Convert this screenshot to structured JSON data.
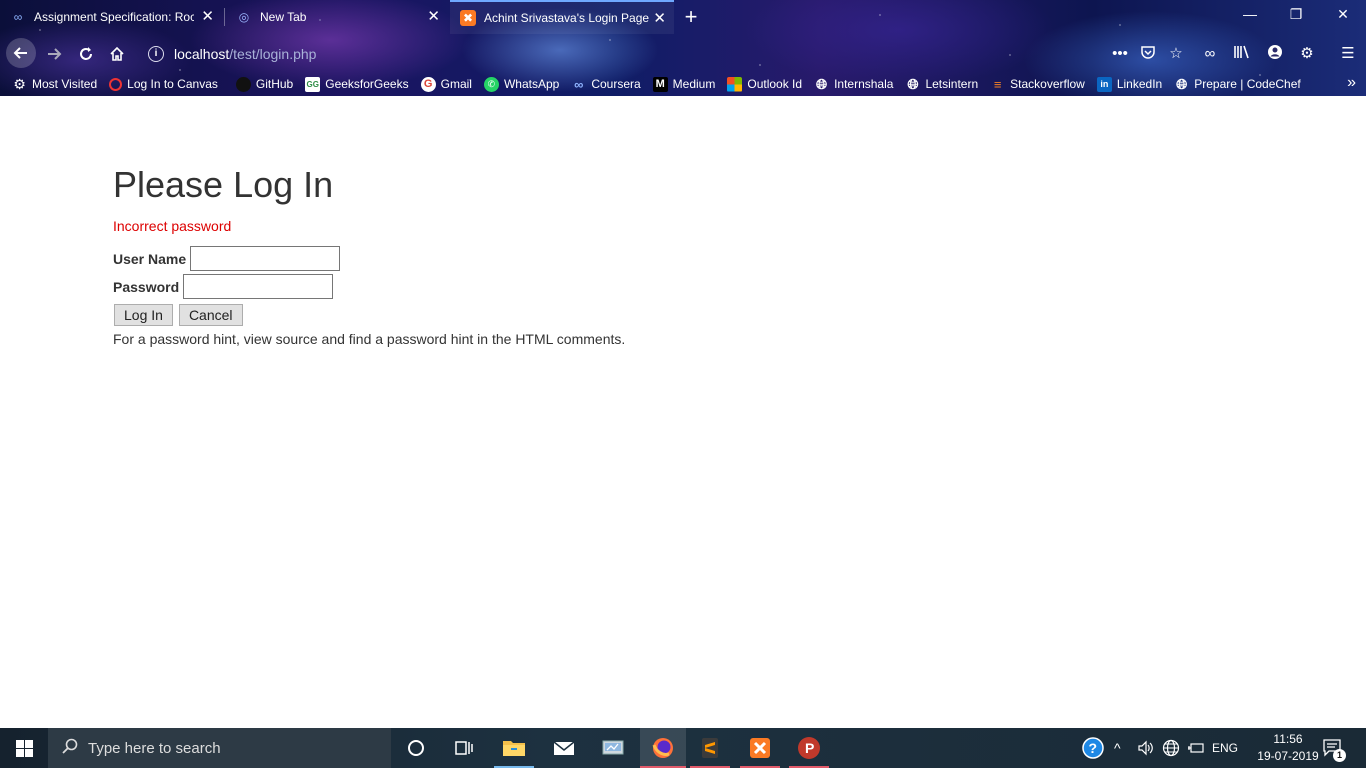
{
  "browser": {
    "tabs": [
      {
        "title": "Assignment Specification: Rock",
        "icon": "coursera-icon"
      },
      {
        "title": "New Tab",
        "icon": "firefox-newtab-icon"
      },
      {
        "title": "Achint Srivastava's Login Page",
        "icon": "xampp-icon",
        "active": true
      }
    ],
    "new_tab_symbol": "+",
    "close_symbol": "✕",
    "url_host": "localhost",
    "url_path": "/test/login.php",
    "bookmarks": [
      {
        "label": "Most Visited",
        "icon": "gear-icon"
      },
      {
        "label": "Log In to Canvas",
        "icon": "canvas-icon"
      },
      {
        "label": "GitHub",
        "icon": "github-icon"
      },
      {
        "label": "GeeksforGeeks",
        "icon": "gfg-icon"
      },
      {
        "label": "Gmail",
        "icon": "google-icon"
      },
      {
        "label": "WhatsApp",
        "icon": "whatsapp-icon"
      },
      {
        "label": "Coursera",
        "icon": "coursera-icon"
      },
      {
        "label": "Medium",
        "icon": "medium-icon"
      },
      {
        "label": "Outlook Id",
        "icon": "microsoft-icon"
      },
      {
        "label": "Internshala",
        "icon": "globe-icon"
      },
      {
        "label": "Letsintern",
        "icon": "globe-icon"
      },
      {
        "label": "Stackoverflow",
        "icon": "stackoverflow-icon"
      },
      {
        "label": "LinkedIn",
        "icon": "linkedin-icon"
      },
      {
        "label": "Prepare | CodeChef",
        "icon": "globe-icon"
      }
    ]
  },
  "page": {
    "title": "Please Log In",
    "error": "Incorrect password",
    "username_label": "User Name",
    "username_value": "",
    "password_label": "Password",
    "password_value": "",
    "login_button": "Log In",
    "cancel_button": "Cancel",
    "hint": "For a password hint, view source and find a password hint in the HTML comments."
  },
  "taskbar": {
    "search_placeholder": "Type here to search",
    "language": "ENG",
    "time": "11:56",
    "date": "19-07-2019",
    "notification_count": "1"
  },
  "colors": {
    "error": "#dd0000",
    "heading": "#333333",
    "accent_tab": "#6fa8ff"
  }
}
